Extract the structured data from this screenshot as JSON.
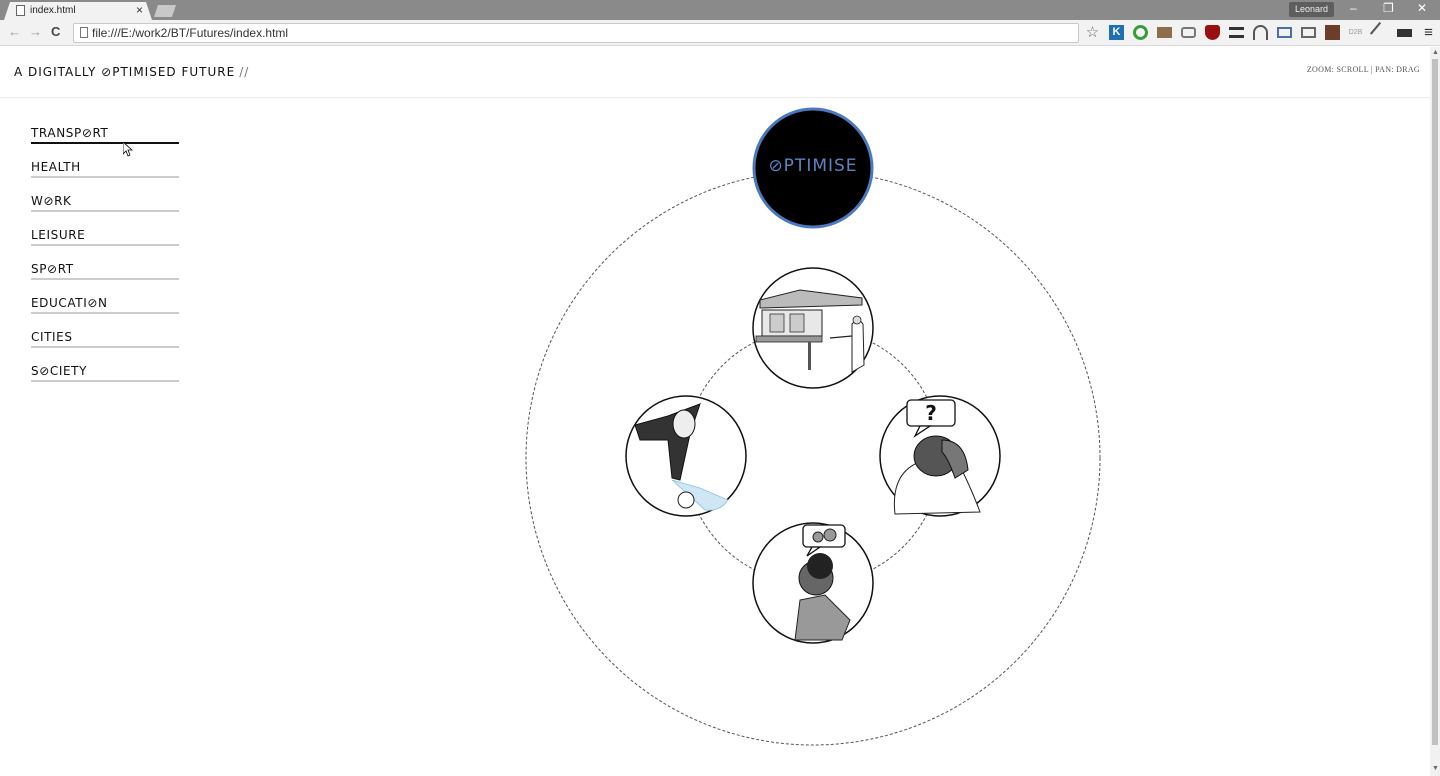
{
  "browser": {
    "tab_title": "index.html",
    "tab_close": "×",
    "profile": "Leonard",
    "url": "file:///E:/work2/BT/Futures/index.html",
    "window_controls": {
      "minimize": "–",
      "restore": "❐",
      "close": "✕"
    },
    "nav": {
      "back": "←",
      "forward": "→",
      "reload": "C"
    },
    "extensions": [
      "star-icon",
      "k-icon",
      "evernote-icon",
      "clapper-icon",
      "camera-icon",
      "ublock-icon",
      "buffer-icon",
      "headphones-icon",
      "frame-icon",
      "cast-icon",
      "avatar-ext-icon",
      "d2b-icon",
      "eyedropper-icon",
      "tag-icon",
      "menu-icon"
    ],
    "ext_labels": {
      "star": "☆",
      "k": "K",
      "d2b": "D2B",
      "menu": "≡"
    }
  },
  "page": {
    "title": "A DIGITALLY ⊘PTIMISED FUTURE",
    "title_suffix": "//",
    "hint": "ZOOM: SCROLL | PAN: DRAG",
    "center_label": "⊘PTIMISE"
  },
  "menu": {
    "items": [
      {
        "label": "TRANSP⊘RT",
        "active": true
      },
      {
        "label": "HEALTH",
        "active": false
      },
      {
        "label": "W⊘RK",
        "active": false
      },
      {
        "label": "LEISURE",
        "active": false
      },
      {
        "label": "SP⊘RT",
        "active": false
      },
      {
        "label": "EDUCATI⊘N",
        "active": false
      },
      {
        "label": "CITIES",
        "active": false
      },
      {
        "label": "S⊘CIETY",
        "active": false
      }
    ]
  },
  "bubbles": {
    "question": "?"
  },
  "colors": {
    "accent": "#5b84c4",
    "node_fill": "#000000"
  }
}
